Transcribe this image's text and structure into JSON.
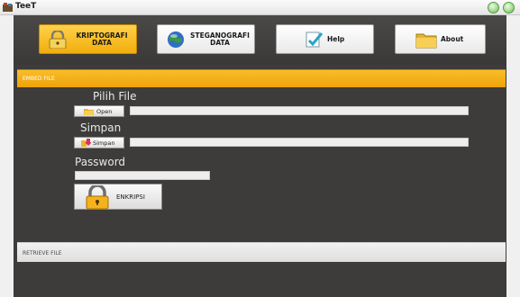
{
  "window": {
    "title": "TeeT"
  },
  "toolbar": {
    "buttons": [
      {
        "line1": "KRIPTOGRAFI",
        "line2": "DATA",
        "icon": "lock-icon",
        "active": true
      },
      {
        "line1": "STEGANOGRAFI",
        "line2": "DATA",
        "icon": "globe-icon",
        "active": false
      },
      {
        "line1": "Help",
        "line2": "",
        "icon": "help-check-icon",
        "active": false
      },
      {
        "line1": "About",
        "line2": "",
        "icon": "folder-icon",
        "active": false
      }
    ]
  },
  "embed": {
    "header": "EMBED FILE",
    "pilih_label": "Pilih File",
    "open_button": "Open",
    "file_value": "",
    "simpan_label": "Simpan",
    "simpan_button": "Simpan",
    "save_value": "",
    "password_label": "Password",
    "password_value": "",
    "enkripsi_button": "ENKRIPSI"
  },
  "retrieve": {
    "header": "RETRIEVE FILE"
  },
  "colors": {
    "accent": "#f5b11a",
    "panel": "#3d3c3a"
  }
}
